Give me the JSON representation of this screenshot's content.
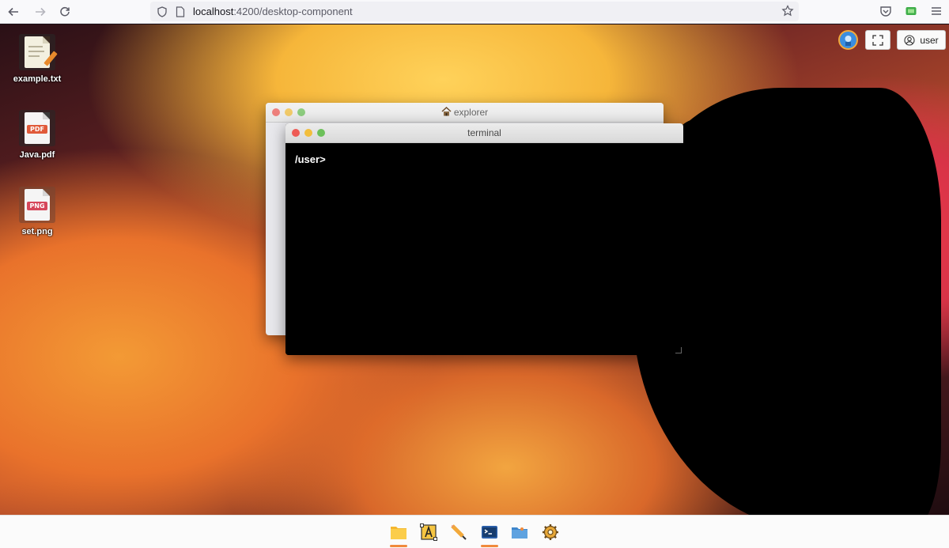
{
  "browser": {
    "url_host": "localhost",
    "url_rest": ":4200/desktop-component",
    "icons": [
      "back-arrow-icon",
      "forward-arrow-icon",
      "reload-icon",
      "shield-icon",
      "page-icon",
      "bookmark-star-icon",
      "pocket-icon",
      "extension-icon",
      "menu-icon"
    ]
  },
  "desktop": {
    "icons": [
      {
        "label": "example.txt",
        "type": "text"
      },
      {
        "label": "Java.pdf",
        "type": "pdf",
        "badge": "PDF"
      },
      {
        "label": "set.png",
        "type": "png",
        "badge": "PNG"
      }
    ],
    "user_button_label": "user"
  },
  "windows": {
    "explorer": {
      "title": "explorer"
    },
    "terminal": {
      "title": "terminal",
      "prompt": "/user>"
    }
  },
  "dock": {
    "items": [
      "files-app-icon",
      "font-app-icon",
      "pencil-app-icon",
      "terminal-app-icon",
      "folder-app-icon",
      "settings-gear-icon"
    ],
    "active": [
      "files-app-icon",
      "terminal-app-icon"
    ]
  },
  "colors": {
    "accent": "#f08a3c",
    "traffic_red": "#ee5b55",
    "traffic_yellow": "#f2be3c",
    "traffic_green": "#6cc05a"
  }
}
